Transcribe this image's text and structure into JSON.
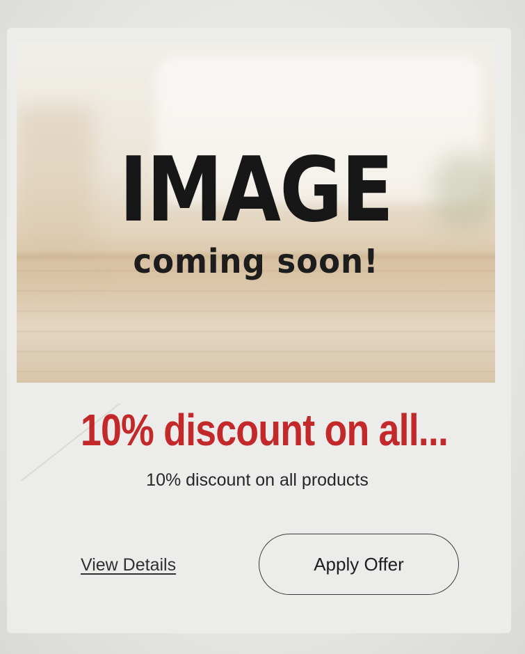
{
  "hero": {
    "title": "IMAGE",
    "subtitle": "coming soon!"
  },
  "offer": {
    "title": "10% discount on all...",
    "description": "10% discount on all products"
  },
  "actions": {
    "view_details_label": "View Details",
    "apply_offer_label": "Apply Offer"
  },
  "colors": {
    "accent_red": "#c3282b",
    "text_dark": "#1e1e1e",
    "background": "#ecedea"
  }
}
